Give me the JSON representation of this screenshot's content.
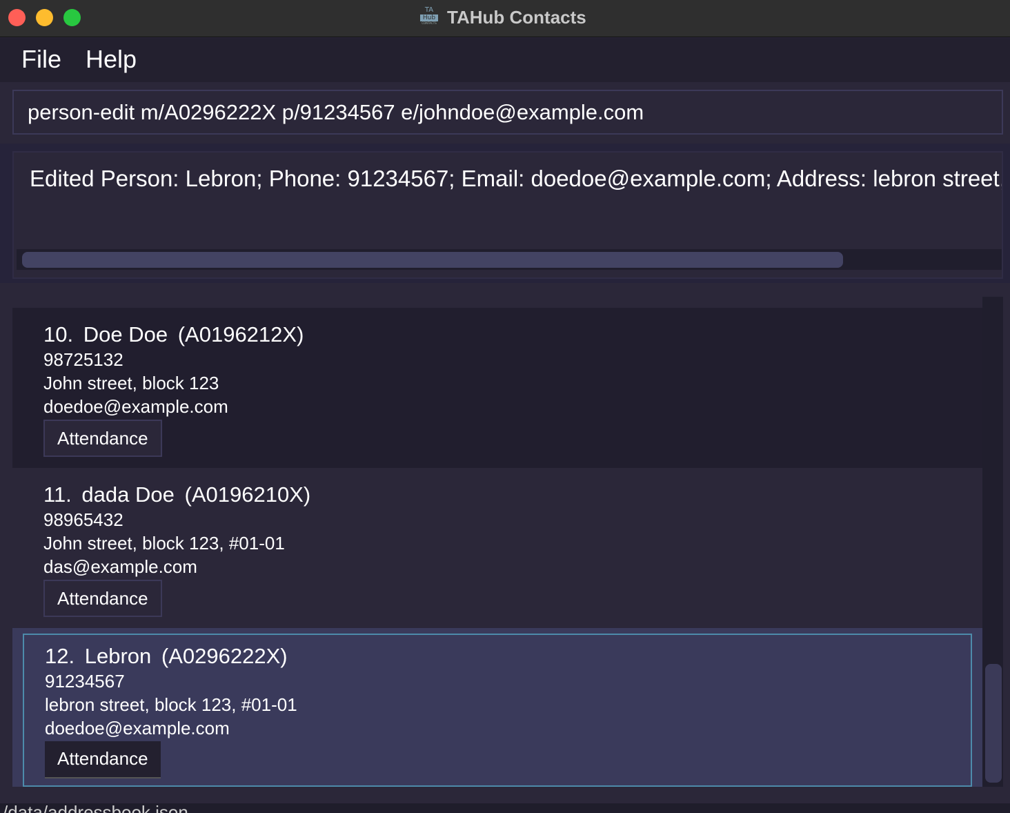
{
  "window": {
    "title": "TAHub Contacts",
    "icon": {
      "top": "TA",
      "middle": "Hub",
      "bottom": "CONTACTS"
    }
  },
  "menu": {
    "file": "File",
    "help": "Help"
  },
  "command_box": {
    "value": "person-edit m/A0296222X p/91234567 e/johndoe@example.com"
  },
  "result_display": {
    "text": "Edited Person: Lebron; Phone: 91234567; Email: doedoe@example.com; Address: lebron street, b"
  },
  "persons": [
    {
      "index": "10.",
      "name": "Doe Doe",
      "matric": "(A0196212X)",
      "phone": "98725132",
      "address": "John street, block 123",
      "email": "doedoe@example.com",
      "button": "Attendance"
    },
    {
      "index": "11.",
      "name": "dada Doe",
      "matric": "(A0196210X)",
      "phone": "98965432",
      "address": "John street, block 123, #01-01",
      "email": "das@example.com",
      "button": "Attendance"
    },
    {
      "index": "12.",
      "name": "Lebron",
      "matric": "(A0296222X)",
      "phone": "91234567",
      "address": "lebron street, block 123, #01-01",
      "email": "doedoe@example.com",
      "button": "Attendance",
      "selected": true
    }
  ],
  "status_bar": {
    "path": "/data/addressbook.json"
  },
  "colors": {
    "background": "#2b2739",
    "selected_card": "#3a3a5b",
    "selected_border": "#4d8bab"
  }
}
